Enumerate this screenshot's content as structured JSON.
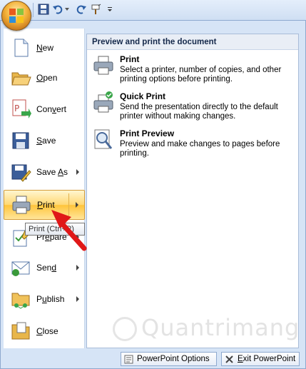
{
  "quick_access": {
    "icons": [
      "save-icon",
      "undo-icon",
      "redo-icon",
      "format-painter-icon",
      "customize-icon"
    ]
  },
  "left_menu": {
    "items": [
      {
        "label": "New",
        "key": "N",
        "icon": "new-document-icon",
        "submenu": false
      },
      {
        "label": "Open",
        "key": "O",
        "icon": "open-folder-icon",
        "submenu": false
      },
      {
        "label": "Convert",
        "key": "v",
        "icon": "convert-icon",
        "submenu": false
      },
      {
        "label": "Save",
        "key": "S",
        "icon": "save-icon",
        "submenu": false
      },
      {
        "label": "Save As",
        "key": "A",
        "icon": "save-as-icon",
        "submenu": true
      },
      {
        "label": "Print",
        "key": "P",
        "icon": "print-icon",
        "submenu": true,
        "active": true
      },
      {
        "label": "Prepare",
        "key": "e",
        "icon": "prepare-icon",
        "submenu": true
      },
      {
        "label": "Send",
        "key": "d",
        "icon": "send-icon",
        "submenu": true
      },
      {
        "label": "Publish",
        "key": "u",
        "icon": "publish-icon",
        "submenu": true
      },
      {
        "label": "Close",
        "key": "C",
        "icon": "close-folder-icon",
        "submenu": false
      }
    ]
  },
  "tooltip": {
    "text": "Print (Ctrl+P)"
  },
  "submenu": {
    "title": "Preview and print the document",
    "items": [
      {
        "title": "Print",
        "desc": "Select a printer, number of copies, and other printing options before printing.",
        "icon": "printer-icon"
      },
      {
        "title": "Quick Print",
        "desc": "Send the presentation directly to the default printer without making changes.",
        "icon": "quick-print-icon"
      },
      {
        "title": "Print Preview",
        "desc": "Preview and make changes to pages before printing.",
        "icon": "print-preview-icon"
      }
    ]
  },
  "watermark": {
    "text": "Quantrimang"
  },
  "footer": {
    "options_label": "PowerPoint Options",
    "exit_label": "Exit PowerPoint"
  },
  "colors": {
    "accent": "#ffc43a",
    "frame": "#d6e4f6",
    "annotation_arrow": "#e01818"
  }
}
